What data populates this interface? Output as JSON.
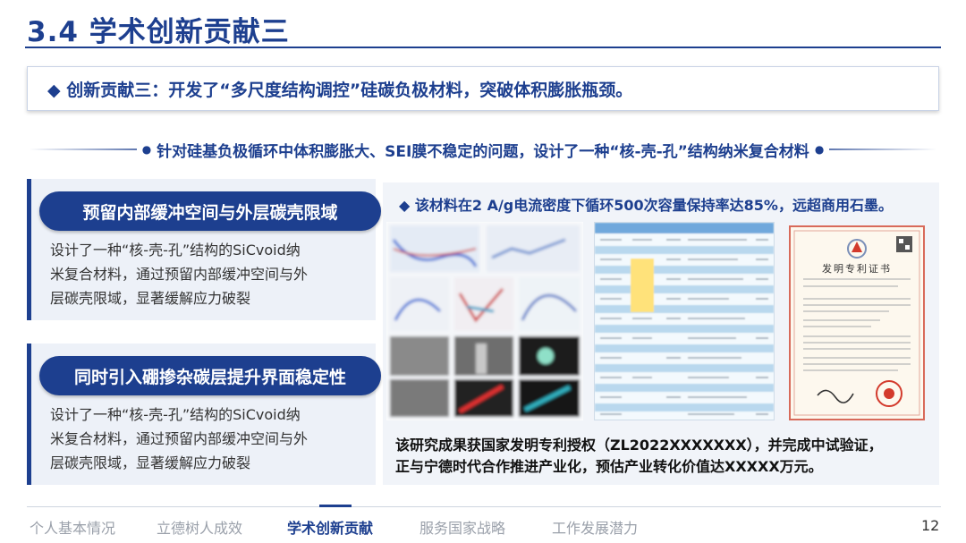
{
  "title": "3.4 学术创新贡献三",
  "banner": "◆ 创新贡献三：开发了“多尺度结构调控”硅碳负极材料，突破体积膨胀瓶颈。",
  "subline": "针对硅基负极循环中体积膨胀大、SEI膜不稳定的问题，设计了一种“核-壳-孔”结构纳米复合材料",
  "cards": [
    {
      "title": "预留内部缓冲空间与外层碳壳限域",
      "lines": [
        "设计了一种“核-壳-孔”结构的SiCvoid纳",
        "米复合材料，通过预留内部缓冲空间与外",
        "层碳壳限域，显著缓解应力破裂"
      ]
    },
    {
      "title": "同时引入硼掺杂碳层提升界面稳定性",
      "lines": [
        "设计了一种“核-壳-孔”结构的SiCvoid纳",
        "米复合材料，通过预留内部缓冲空间与外",
        "层碳壳限域，显著缓解应力破裂"
      ]
    }
  ],
  "right": {
    "head": "◆ 该材料在2 A/g电流密度下循环500次容量保持率达85%，远超商用石墨。",
    "conclusion": [
      "该研究成果获国家发明专利授权（ZL2022XXXXXXX），并完成中试验证，",
      "正与宁德时代合作推进产业化，预估产业转化价值达XXXXX万元。"
    ],
    "certificate_title": "发明专利证书"
  },
  "footer": {
    "nav": [
      "个人基本情况",
      "立德树人成效",
      "学术创新贡献",
      "服务国家战略",
      "工作发展潜力"
    ],
    "active_index": 2,
    "page": "12"
  },
  "colors": {
    "primary": "#1d3f8f",
    "muted": "#9aa0aa",
    "panel": "#edf1f8",
    "seal": "#d33a2c"
  }
}
